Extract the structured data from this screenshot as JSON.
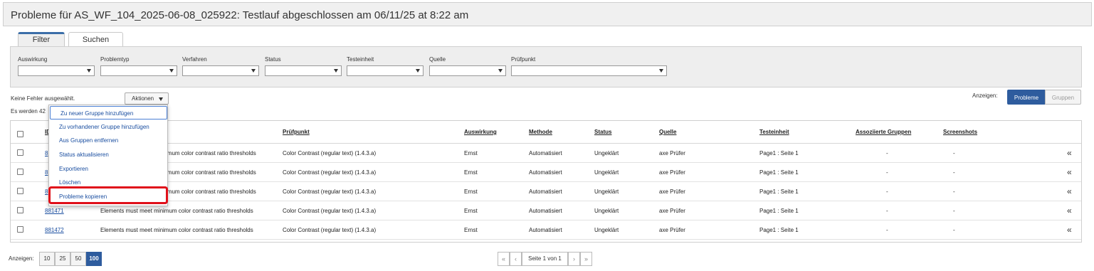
{
  "title": "Probleme für AS_WF_104_2025-06-08_025922: Testlauf abgeschlossen am 06/11/25 at 8:22 am",
  "tabs": {
    "filter": "Filter",
    "search": "Suchen"
  },
  "filters": {
    "auswirkung": "Auswirkung",
    "problemtyp": "Problemtyp",
    "verfahren": "Verfahren",
    "status": "Status",
    "testeinheit": "Testeinheit",
    "quelle": "Quelle",
    "pruefpunkt": "Prüfpunkt"
  },
  "selection_info": "Keine Fehler ausgewählt.",
  "count_info": "Es werden 42",
  "actions_label": "Aktionen",
  "show_label": "Anzeigen:",
  "view_toggle": {
    "problems": "Probleme",
    "groups": "Gruppen"
  },
  "menu": [
    "Zu neuer Gruppe hinzufügen",
    "Zu vorhandener Gruppe hinzufügen",
    "Aus Gruppen entfernen",
    "Status aktualisieren",
    "Exportieren",
    "Löschen",
    "Probleme kopieren"
  ],
  "columns": {
    "id": "ID",
    "pruefpunkt": "Prüfpunkt",
    "auswirkung": "Auswirkung",
    "methode": "Methode",
    "status": "Status",
    "quelle": "Quelle",
    "testeinheit": "Testeinheit",
    "gruppen": "Assoziierte Gruppen",
    "screenshots": "Screenshots"
  },
  "rows": [
    {
      "id": "8",
      "problem": "imum color contrast ratio thresholds",
      "pruefpunkt": "Color Contrast (regular text) (1.4.3.a)",
      "auswirkung": "Ernst",
      "methode": "Automatisiert",
      "status": "Ungeklärt",
      "quelle": "axe Prüfer",
      "testeinheit": "Page1 : Seite 1",
      "gruppen": "-",
      "screenshots": "-"
    },
    {
      "id": "8",
      "problem": "imum color contrast ratio thresholds",
      "pruefpunkt": "Color Contrast (regular text) (1.4.3.a)",
      "auswirkung": "Ernst",
      "methode": "Automatisiert",
      "status": "Ungeklärt",
      "quelle": "axe Prüfer",
      "testeinheit": "Page1 : Seite 1",
      "gruppen": "-",
      "screenshots": "-"
    },
    {
      "id": "8",
      "problem": "imum color contrast ratio thresholds",
      "pruefpunkt": "Color Contrast (regular text) (1.4.3.a)",
      "auswirkung": "Ernst",
      "methode": "Automatisiert",
      "status": "Ungeklärt",
      "quelle": "axe Prüfer",
      "testeinheit": "Page1 : Seite 1",
      "gruppen": "-",
      "screenshots": "-"
    },
    {
      "id": "881471",
      "problem": "Elements must meet minimum color contrast ratio thresholds",
      "pruefpunkt": "Color Contrast (regular text) (1.4.3.a)",
      "auswirkung": "Ernst",
      "methode": "Automatisiert",
      "status": "Ungeklärt",
      "quelle": "axe Prüfer",
      "testeinheit": "Page1 : Seite 1",
      "gruppen": "-",
      "screenshots": "-"
    },
    {
      "id": "881472",
      "problem": "Elements must meet minimum color contrast ratio thresholds",
      "pruefpunkt": "Color Contrast (regular text) (1.4.3.a)",
      "auswirkung": "Ernst",
      "methode": "Automatisiert",
      "status": "Ungeklärt",
      "quelle": "axe Prüfer",
      "testeinheit": "Page1 : Seite 1",
      "gruppen": "-",
      "screenshots": "-"
    }
  ],
  "expander_glyph": "«",
  "pager": {
    "show_label": "Anzeigen:",
    "sizes": [
      "10",
      "25",
      "50",
      "100"
    ],
    "selected_size": "100",
    "first": "«",
    "prev": "‹",
    "page_text": "Seite 1 von 1",
    "next": "›",
    "last": "»"
  },
  "colors": {
    "accent": "#2e5c9e",
    "link": "#1a4ea0",
    "highlight": "#e0101a"
  }
}
